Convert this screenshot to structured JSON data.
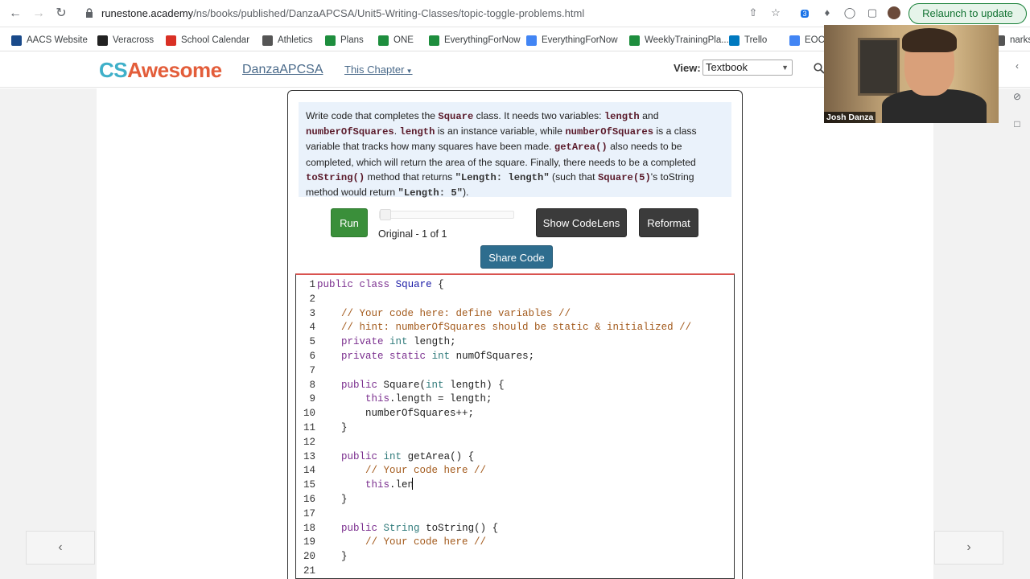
{
  "browser": {
    "url_domain": "runestone.academy",
    "url_path": "/ns/books/published/DanzaAPCSA/Unit5-Writing-Classes/topic-toggle-problems.html",
    "relaunch_label": "Relaunch to update",
    "ext_badge": "3"
  },
  "bookmarks": [
    {
      "label": "AACS Website",
      "color": "#1a4a8a"
    },
    {
      "label": "Veracross",
      "color": "#222"
    },
    {
      "label": "School Calendar",
      "color": "#d93025"
    },
    {
      "label": "Athletics",
      "color": "#555"
    },
    {
      "label": "Plans",
      "color": "#1e8e3e"
    },
    {
      "label": "ONE",
      "color": "#1e8e3e"
    },
    {
      "label": "EverythingForNow",
      "color": "#1e8e3e"
    },
    {
      "label": "EverythingForNow",
      "color": "#4285f4"
    },
    {
      "label": "WeeklyTrainingPla...",
      "color": "#1e8e3e"
    },
    {
      "label": "Trello",
      "color": "#0079bf"
    },
    {
      "label": "EOC",
      "color": "#4285f4"
    },
    {
      "label": "narks",
      "color": "#555"
    }
  ],
  "header": {
    "logo_cs": "CS",
    "logo_awesome": "Awesome",
    "book_title": "DanzaAPCSA",
    "chapter_menu": "This Chapter",
    "view_label": "View:",
    "view_value": "Textbook"
  },
  "problem": {
    "d1": "Write code that completes the ",
    "c1": "Square",
    "d2": " class. It needs two variables: ",
    "c2": "length",
    "d3": " and ",
    "c3": "numberOfSquares",
    "d4": ". ",
    "c4": "length",
    "d5": " is an instance variable, while ",
    "c5": "numberOfSquares",
    "d6": " is a class variable that tracks how many squares have been made. ",
    "c6": "getArea()",
    "d7": " also needs to be completed, which will return the area of the square. Finally, there needs to be a completed ",
    "c7": "toString()",
    "d8": " method that returns ",
    "c8": "\"Length: length\"",
    "d9": " (such that ",
    "c9": "Square(5)",
    "d10": "'s toString method would return ",
    "c10": "\"Length: 5\"",
    "d11": ")."
  },
  "controls": {
    "run_label": "Run",
    "version_label": "Original - 1 of 1",
    "codelens_label": "Show CodeLens",
    "reformat_label": "Reformat",
    "share_label": "Share Code"
  },
  "code_lines": [
    {
      "n": "1",
      "t": "public class Square {"
    },
    {
      "n": "2",
      "t": ""
    },
    {
      "n": "3",
      "t": "    // Your code here: define variables //"
    },
    {
      "n": "4",
      "t": "    // hint: numberOfSquares should be static & initialized //"
    },
    {
      "n": "5",
      "t": "    private int length;"
    },
    {
      "n": "6",
      "t": "    private static int numOfSquares;"
    },
    {
      "n": "7",
      "t": ""
    },
    {
      "n": "8",
      "t": "    public Square(int length) {"
    },
    {
      "n": "9",
      "t": "        this.length = length;"
    },
    {
      "n": "10",
      "t": "        numberOfSquares++;"
    },
    {
      "n": "11",
      "t": "    }"
    },
    {
      "n": "12",
      "t": ""
    },
    {
      "n": "13",
      "t": "    public int getArea() {"
    },
    {
      "n": "14",
      "t": "        // Your code here //"
    },
    {
      "n": "15",
      "t": "        this.len"
    },
    {
      "n": "16",
      "t": "    }"
    },
    {
      "n": "17",
      "t": ""
    },
    {
      "n": "18",
      "t": "    public String toString() {"
    },
    {
      "n": "19",
      "t": "        // Your code here //"
    },
    {
      "n": "20",
      "t": "    }"
    },
    {
      "n": "21",
      "t": ""
    }
  ],
  "webcam": {
    "name": "Josh Danza"
  }
}
